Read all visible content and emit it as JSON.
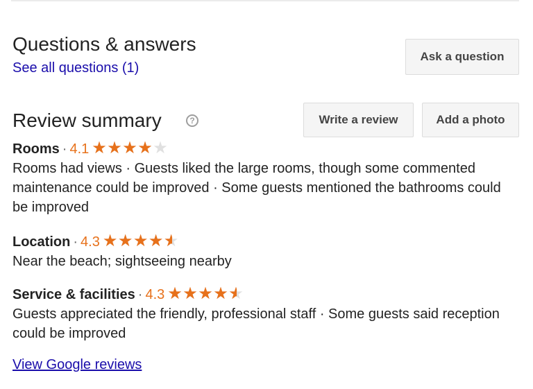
{
  "questions": {
    "title": "Questions & answers",
    "see_all": "See all questions (1)",
    "ask_button": "Ask a question"
  },
  "review_summary": {
    "title": "Review summary",
    "help_icon": "?",
    "write_button": "Write a review",
    "photo_button": "Add a photo",
    "categories": [
      {
        "name": "Rooms",
        "rating": "4.1",
        "stars": 4.1,
        "description": "Rooms had views · Guests liked the large rooms, though some commented maintenance could be improved · Some guests mentioned the bathrooms could be improved"
      },
      {
        "name": "Location",
        "rating": "4.3",
        "stars": 4.3,
        "description": "Near the beach; sightseeing nearby"
      },
      {
        "name": "Service & facilities",
        "rating": "4.3",
        "stars": 4.3,
        "description": "Guests appreciated the friendly, professional staff · Some guests said reception could be improved"
      }
    ],
    "view_reviews_link": "View Google reviews"
  },
  "colors": {
    "star_filled": "#e7711b",
    "star_empty": "#e0e0e0",
    "link": "#1a0dab"
  },
  "icons": {
    "help": "question-circle-icon",
    "star": "star-icon"
  },
  "separator": "·"
}
